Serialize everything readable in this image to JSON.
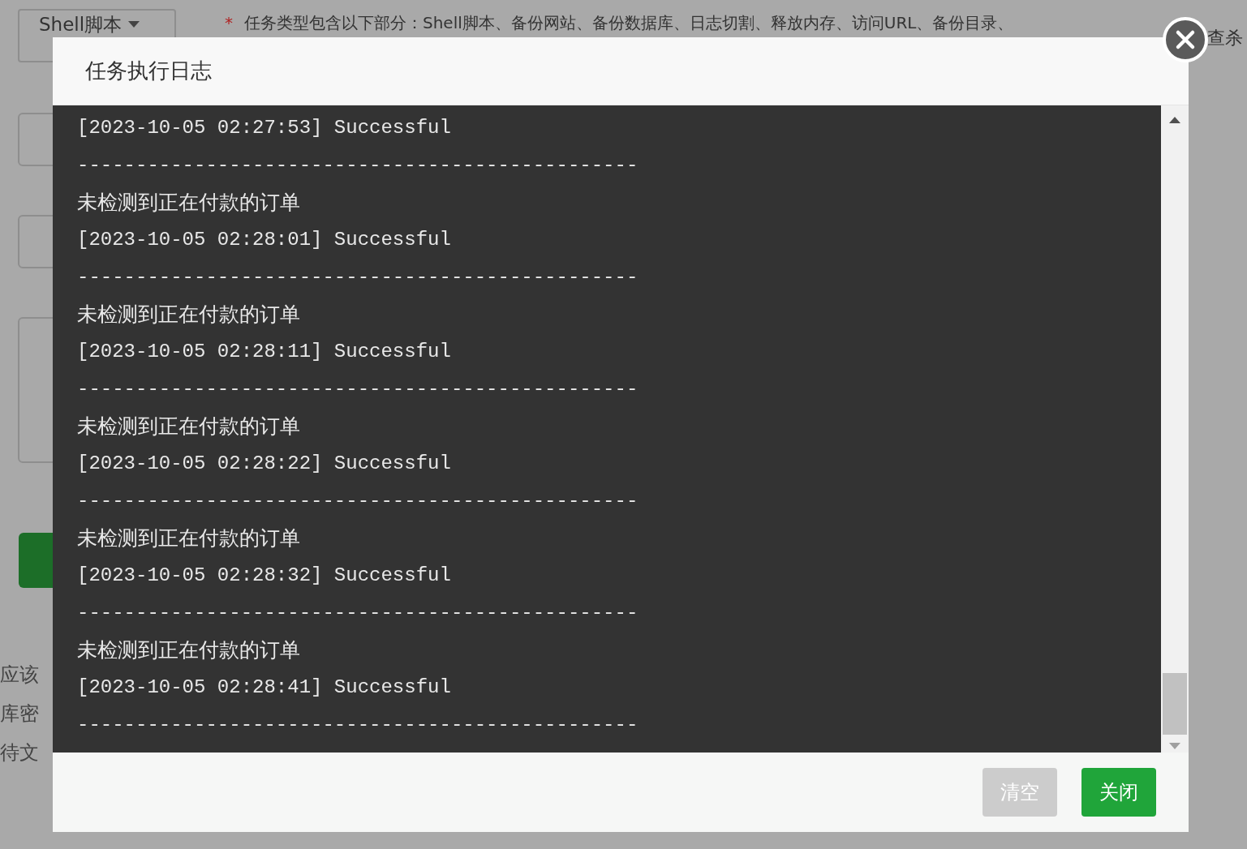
{
  "background": {
    "type_select": {
      "value": "Shell脚本"
    },
    "note": {
      "marker": "*",
      "text": "任务类型包含以下部分：Shell脚本、备份网站、备份数据库、日志切割、释放内存、访问URL、备份目录、"
    },
    "trailing_text": "查杀",
    "side_texts": [
      "应该",
      "库密",
      "待文"
    ]
  },
  "dialog": {
    "title": "任务执行日志",
    "log_lines": [
      {
        "kind": "entry",
        "text": "[2023-10-05 02:27:53] Successful"
      },
      {
        "kind": "separator",
        "text": "------------------------------------------------"
      },
      {
        "kind": "message",
        "text": "未检测到正在付款的订单"
      },
      {
        "kind": "entry",
        "text": "[2023-10-05 02:28:01] Successful"
      },
      {
        "kind": "separator",
        "text": "------------------------------------------------"
      },
      {
        "kind": "message",
        "text": "未检测到正在付款的订单"
      },
      {
        "kind": "entry",
        "text": "[2023-10-05 02:28:11] Successful"
      },
      {
        "kind": "separator",
        "text": "------------------------------------------------"
      },
      {
        "kind": "message",
        "text": "未检测到正在付款的订单"
      },
      {
        "kind": "entry",
        "text": "[2023-10-05 02:28:22] Successful"
      },
      {
        "kind": "separator",
        "text": "------------------------------------------------"
      },
      {
        "kind": "message",
        "text": "未检测到正在付款的订单"
      },
      {
        "kind": "entry",
        "text": "[2023-10-05 02:28:32] Successful"
      },
      {
        "kind": "separator",
        "text": "------------------------------------------------"
      },
      {
        "kind": "message",
        "text": "未检测到正在付款的订单"
      },
      {
        "kind": "entry",
        "text": "[2023-10-05 02:28:41] Successful"
      },
      {
        "kind": "separator",
        "text": "------------------------------------------------"
      }
    ],
    "buttons": [
      {
        "label": "清空",
        "kind": "secondary"
      },
      {
        "label": "关闭",
        "kind": "primary"
      }
    ]
  }
}
